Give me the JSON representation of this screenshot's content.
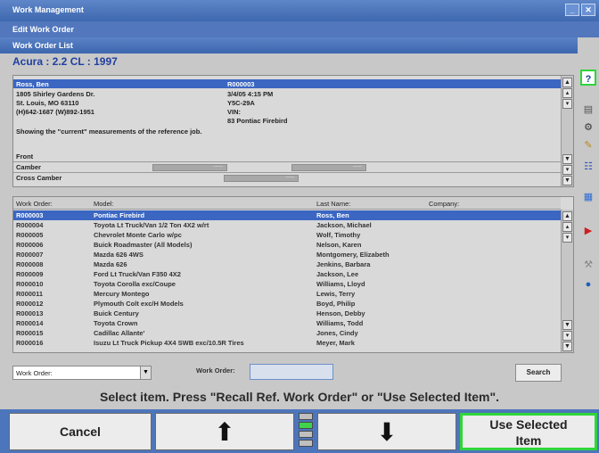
{
  "window": {
    "title": "Work Management",
    "menu_label": "Edit Work Order",
    "panel_title": "Work Order List"
  },
  "vehicle_title": "Acura : 2.2 CL : 1997",
  "reference": {
    "customer_name": "Ross, Ben",
    "work_order_no": "R000003",
    "address_line1": "1805 Shirley Gardens Dr.",
    "address_line2": "St. Louis, MO  63110",
    "phone": "(H)642-1687 (W)892-1951",
    "date_time": "3/4/05 4:15 PM",
    "plate": "Y5C-29A",
    "vin_label": "VIN:",
    "vehicle": "83 Pontiac Firebird",
    "status_text": "Showing the \"current\" measurements of the reference job.",
    "section": "Front",
    "rows": [
      {
        "label": "Camber"
      },
      {
        "label": "Cross Camber"
      }
    ]
  },
  "work_orders": {
    "columns": [
      "Work Order:",
      "Model:",
      "Last Name:",
      "Company:"
    ],
    "selected_index": 0,
    "rows": [
      {
        "work_order": "R000003",
        "model": "Pontiac Firebird",
        "last_name": "Ross, Ben",
        "company": ""
      },
      {
        "work_order": "R000004",
        "model": "Toyota Lt Truck/Van 1/2 Ton 4X2 w/rt",
        "last_name": "Jackson, Michael",
        "company": ""
      },
      {
        "work_order": "R000005",
        "model": "Chevrolet Monte Carlo w/pc",
        "last_name": "Wolf, Timothy",
        "company": ""
      },
      {
        "work_order": "R000006",
        "model": "Buick Roadmaster (All Models)",
        "last_name": "Nelson, Karen",
        "company": ""
      },
      {
        "work_order": "R000007",
        "model": "Mazda 626 4WS",
        "last_name": "Montgomery, Elizabeth",
        "company": ""
      },
      {
        "work_order": "R000008",
        "model": "Mazda 626",
        "last_name": "Jenkins, Barbara",
        "company": ""
      },
      {
        "work_order": "R000009",
        "model": "Ford Lt Truck/Van F350 4X2",
        "last_name": "Jackson, Lee",
        "company": ""
      },
      {
        "work_order": "R000010",
        "model": "Toyota Corolla exc/Coupe",
        "last_name": "Williams, Lloyd",
        "company": ""
      },
      {
        "work_order": "R000011",
        "model": "Mercury Montego",
        "last_name": "Lewis, Terry",
        "company": ""
      },
      {
        "work_order": "R000012",
        "model": "Plymouth Colt exc/H Models",
        "last_name": "Boyd, Philip",
        "company": ""
      },
      {
        "work_order": "R000013",
        "model": "Buick Century",
        "last_name": "Henson, Debby",
        "company": ""
      },
      {
        "work_order": "R000014",
        "model": "Toyota Crown",
        "last_name": "Williams, Todd",
        "company": ""
      },
      {
        "work_order": "R000015",
        "model": "Cadillac Allante'",
        "last_name": "Jones, Cindy",
        "company": ""
      },
      {
        "work_order": "R000016",
        "model": "Isuzu Lt Truck Pickup 4X4 SWB exc/10.5R Tires",
        "last_name": "Meyer, Mark",
        "company": ""
      }
    ]
  },
  "search": {
    "field_select": "Work Order:",
    "field_label": "Work Order:",
    "input_value": "",
    "button_label": "Search"
  },
  "instruction": "Select item.  Press \"Recall Ref. Work Order\" or \"Use Selected Item\".",
  "bottom": {
    "cancel_label": "Cancel",
    "use_selected_line1": "Use Selected",
    "use_selected_line2": "Item"
  },
  "colors": {
    "selection": "#3b66c2",
    "title_blue": "#3e68b0",
    "accent_green": "#2fd53a"
  },
  "side_icons": [
    "help-icon",
    "print-icon",
    "settings-icon",
    "tool-icon",
    "ruler-icon",
    "globe-icon"
  ]
}
